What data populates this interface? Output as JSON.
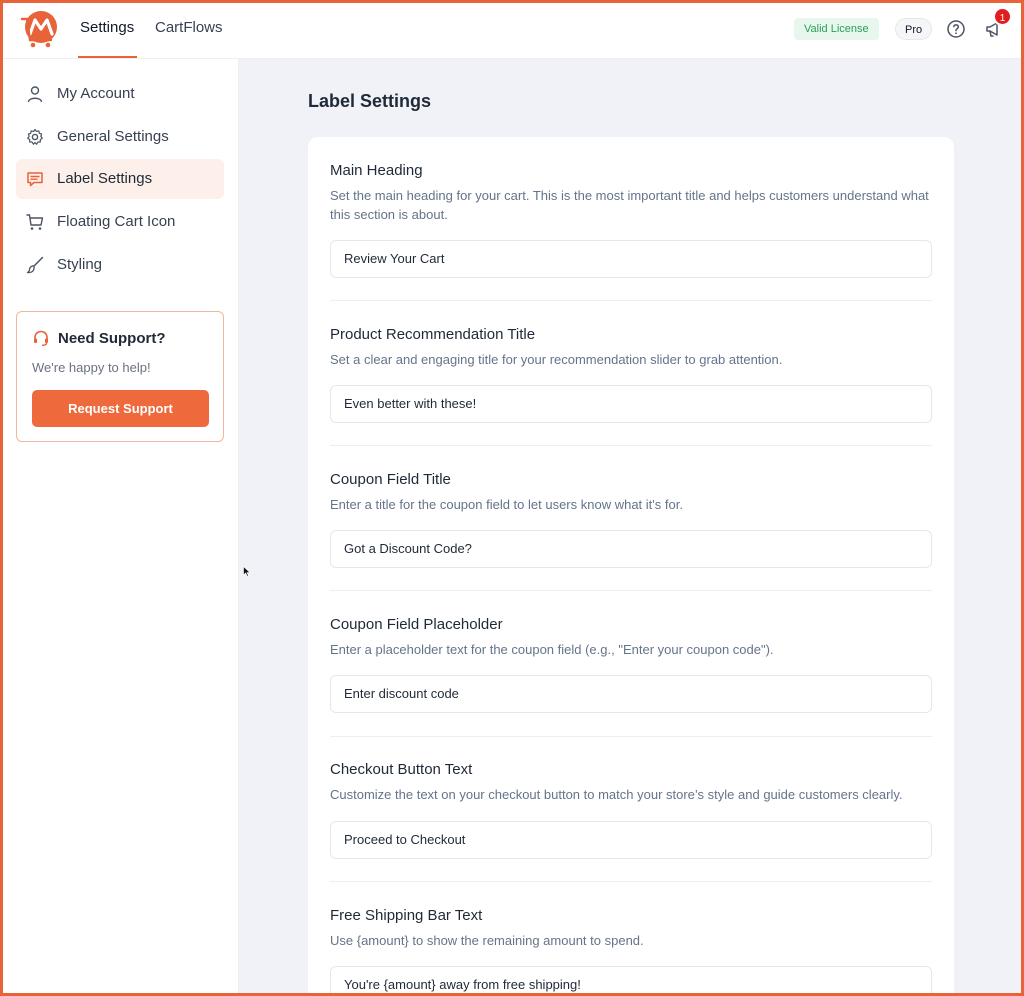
{
  "header": {
    "tabs": [
      {
        "label": "Settings",
        "active": true
      },
      {
        "label": "CartFlows",
        "active": false
      }
    ],
    "license_badge": "Valid License",
    "plan_badge": "Pro",
    "notification_count": "1",
    "icons": [
      "logo-icon",
      "help-icon",
      "megaphone-icon"
    ]
  },
  "sidebar": {
    "items": [
      {
        "label": "My Account",
        "icon": "user-icon",
        "active": false
      },
      {
        "label": "General Settings",
        "icon": "gear-icon",
        "active": false
      },
      {
        "label": "Label Settings",
        "icon": "message-icon",
        "active": true
      },
      {
        "label": "Floating Cart Icon",
        "icon": "cart-icon",
        "active": false
      },
      {
        "label": "Styling",
        "icon": "brush-icon",
        "active": false
      }
    ],
    "support": {
      "title": "Need Support?",
      "subtitle": "We're happy to help!",
      "button_label": "Request Support",
      "icon": "headset-icon"
    }
  },
  "main": {
    "page_title": "Label Settings",
    "sections": [
      {
        "title": "Main Heading",
        "description": "Set the main heading for your cart. This is the most important title and helps customers understand what this section is about.",
        "value": "Review Your Cart"
      },
      {
        "title": "Product Recommendation Title",
        "description": "Set a clear and engaging title for your recommendation slider to grab attention.",
        "value": "Even better with these!"
      },
      {
        "title": "Coupon Field Title",
        "description": "Enter a title for the coupon field to let users know what it's for.",
        "value": "Got a Discount Code?"
      },
      {
        "title": "Coupon Field Placeholder",
        "description": "Enter a placeholder text for the coupon field (e.g., \"Enter your coupon code\").",
        "value": "Enter discount code"
      },
      {
        "title": "Checkout Button Text",
        "description": "Customize the text on your checkout button to match your store’s style and guide customers clearly.",
        "value": "Proceed to Checkout"
      },
      {
        "title": "Free Shipping Bar Text",
        "description": "Use {amount} to show the remaining amount to spend.",
        "value": "You're {amount} away from free shipping!"
      }
    ]
  },
  "colors": {
    "accent": "#ee6a3c",
    "active_bg": "#fdf0ea",
    "license_bg": "#e8f7ee",
    "license_text": "#2e9b5a",
    "main_bg": "#f0f2f7",
    "badge": "#e11d1d"
  }
}
